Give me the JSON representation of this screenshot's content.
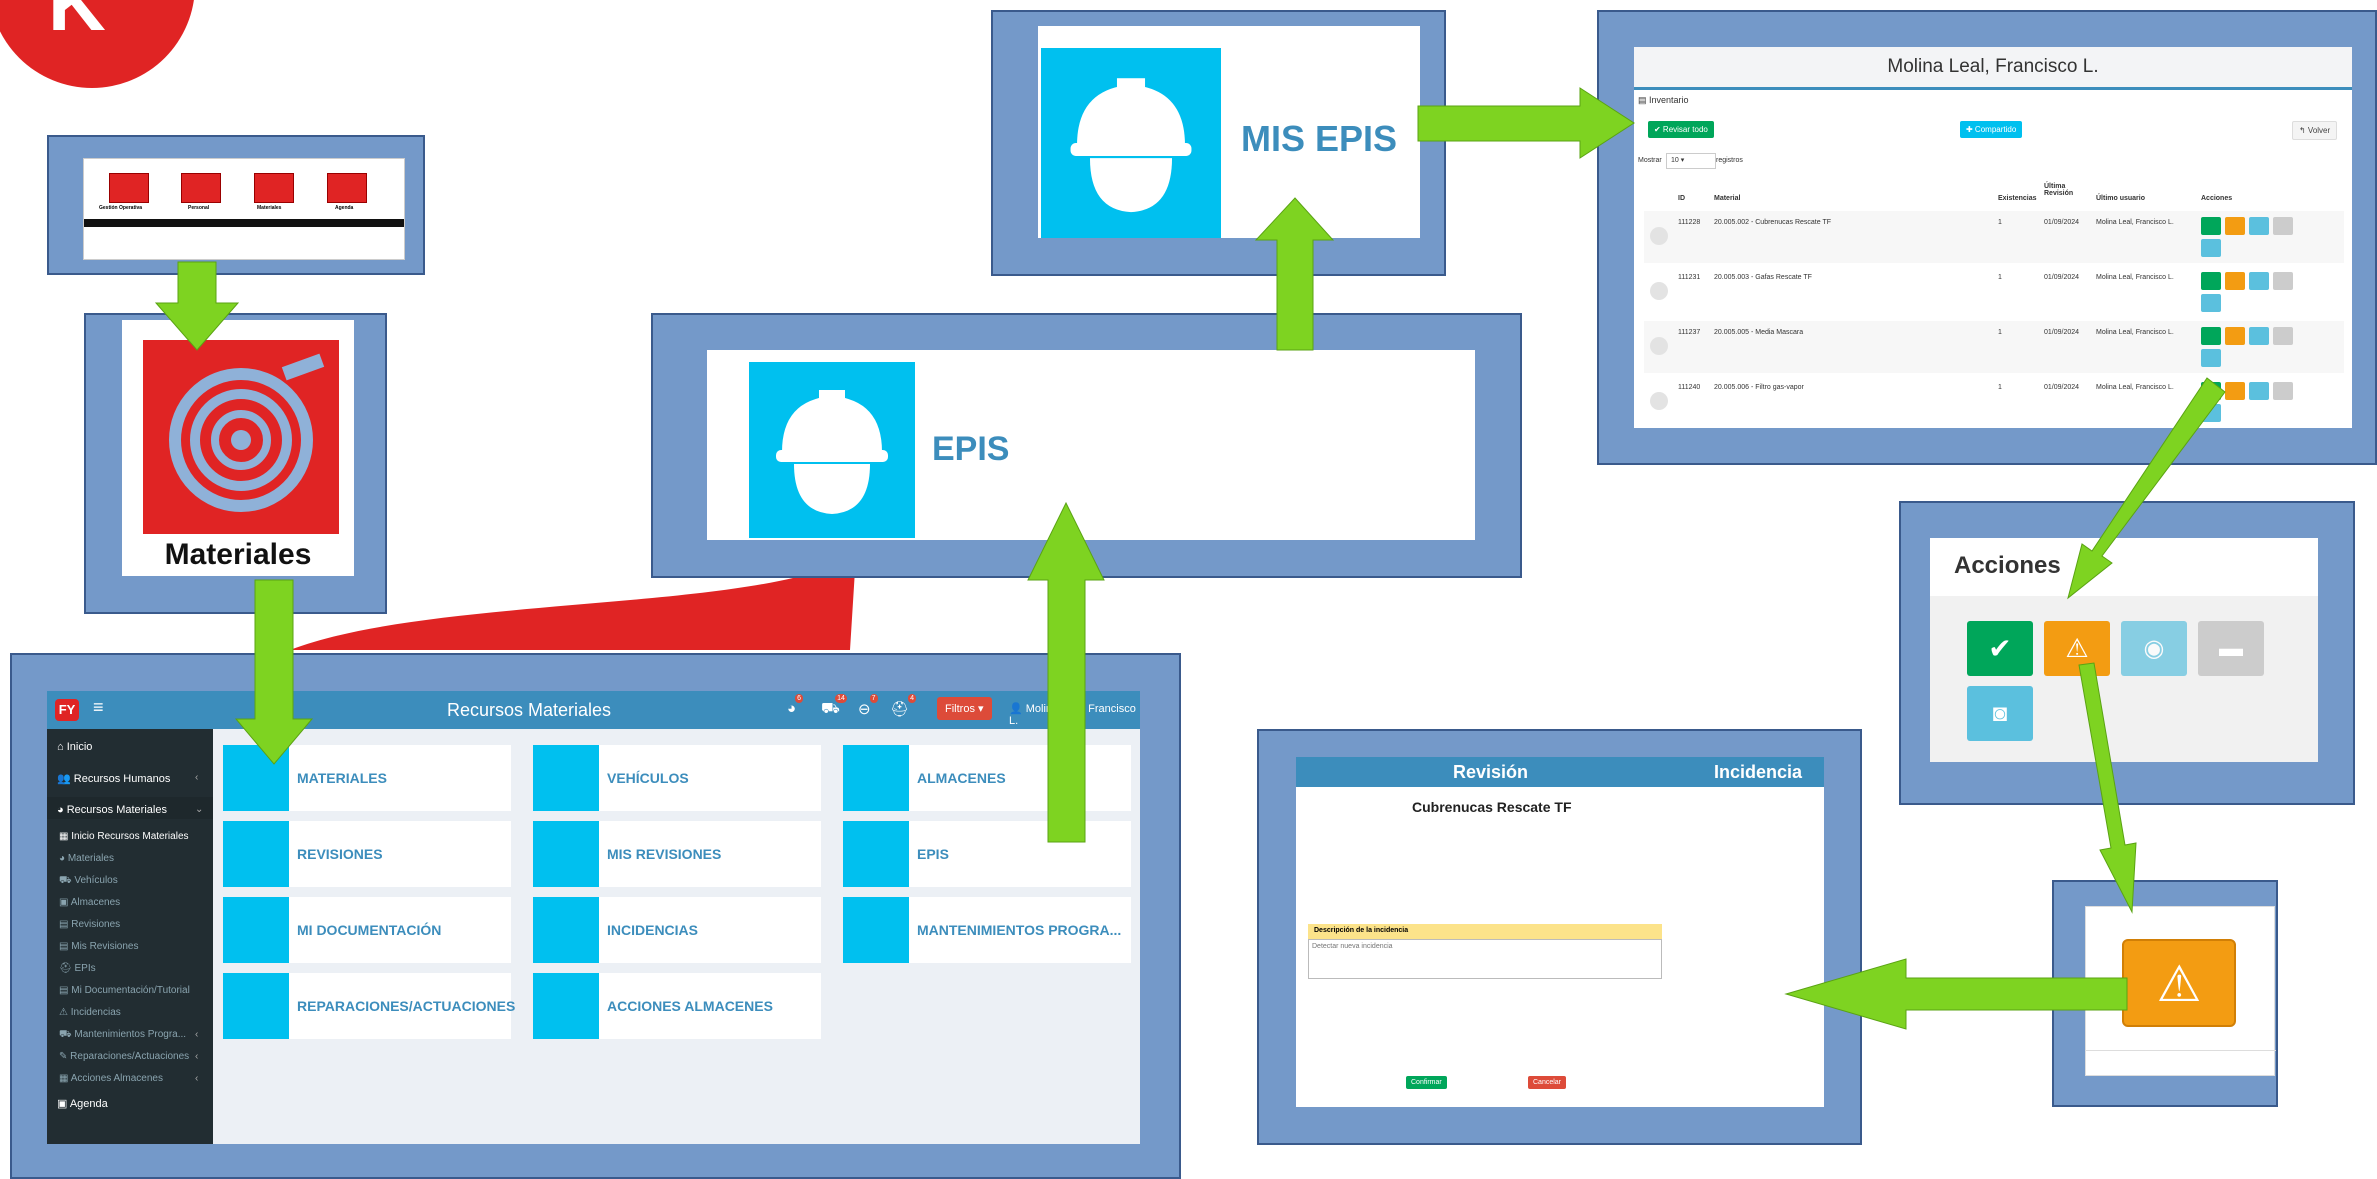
{
  "colors": {
    "frame": "#7499c9",
    "accent": "#00c0ef",
    "arrow": "#7ed321",
    "danger": "#dd4b39",
    "success": "#00a65a",
    "warning": "#f39c12"
  },
  "menu_strip": {
    "items": [
      "Gestión Operativa",
      "Personal",
      "Materiales",
      "Agenda"
    ]
  },
  "materiales_card": {
    "label": "Materiales",
    "icon": "fire-hose-icon"
  },
  "epis_card": {
    "label": "EPIS",
    "icon": "helmet-icon"
  },
  "mis_epis_card": {
    "label": "MIS EPIS",
    "icon": "helmet-icon"
  },
  "dashboard": {
    "brand": "FY",
    "title": "Recursos Materiales",
    "badges": [
      "6",
      "14",
      "7",
      "4"
    ],
    "filters_label": "Filtros ▾",
    "user": "Molina Leal, Francisco L.",
    "sidebar": [
      {
        "label": "Inicio"
      },
      {
        "label": "Recursos Humanos"
      },
      {
        "label": "Recursos Materiales"
      },
      {
        "label": "Inicio Recursos Materiales"
      },
      {
        "label": "Materiales"
      },
      {
        "label": "Vehículos"
      },
      {
        "label": "Almacenes"
      },
      {
        "label": "Revisiones"
      },
      {
        "label": "Mis Revisiones"
      },
      {
        "label": "EPIs"
      },
      {
        "label": "Mi Documentación/Tutorial"
      },
      {
        "label": "Incidencias"
      },
      {
        "label": "Mantenimientos Progra..."
      },
      {
        "label": "Reparaciones/Actuaciones"
      },
      {
        "label": "Acciones Almacenes"
      },
      {
        "label": "Agenda"
      }
    ],
    "tiles": [
      {
        "label": "MATERIALES",
        "icon": "hose-icon"
      },
      {
        "label": "VEHÍCULOS",
        "icon": "truck-icon"
      },
      {
        "label": "ALMACENES",
        "icon": "warehouse-icon"
      },
      {
        "label": "REVISIONES",
        "icon": "clipboard-check-icon"
      },
      {
        "label": "MIS REVISIONES",
        "icon": "clipboard-search-icon"
      },
      {
        "label": "EPIS",
        "icon": "helmet-icon"
      },
      {
        "label": "MI DOCUMENTACIÓN",
        "icon": "documents-icon"
      },
      {
        "label": "INCIDENCIAS",
        "icon": "warning-icon"
      },
      {
        "label": "MANTENIMIENTOS PROGRA...",
        "icon": "truck-wrench-icon"
      },
      {
        "label": "REPARACIONES/ACTUACIONES",
        "icon": "wrench-icon"
      },
      {
        "label": "ACCIONES ALMACENES",
        "icon": "sitemap-icon"
      }
    ]
  },
  "inventory": {
    "title": "Molina Leal, Francisco L.",
    "section": "Inventario",
    "review_all": "✔ Revisar todo",
    "share": "✚ Compartido",
    "back": "↰ Volver",
    "show_label": "Mostrar",
    "show_value": "10",
    "records_label": "registros",
    "columns": [
      "ID",
      "Material",
      "Existencias",
      "Última Revisión",
      "Último usuario",
      "Acciones"
    ],
    "rows": [
      {
        "id": "111228",
        "material": "20.005.002 - Cubrenucas Rescate TF",
        "stock": "1",
        "date": "01/09/2024",
        "user": "Molina Leal, Francisco L."
      },
      {
        "id": "111231",
        "material": "20.005.003 - Gafas Rescate TF",
        "stock": "1",
        "date": "01/09/2024",
        "user": "Molina Leal, Francisco L."
      },
      {
        "id": "111237",
        "material": "20.005.005 - Media Mascara",
        "stock": "1",
        "date": "01/09/2024",
        "user": "Molina Leal, Francisco L."
      },
      {
        "id": "111240",
        "material": "20.005.006 - Filtro gas-vapor",
        "stock": "1",
        "date": "01/09/2024",
        "user": "Molina Leal, Francisco L."
      }
    ]
  },
  "acciones": {
    "title": "Acciones"
  },
  "incidencia": {
    "tab_revision": "Revisión",
    "tab_incidencia": "Incidencia",
    "item": "Cubrenucas Rescate TF",
    "field_label": "Descripción de la incidencia",
    "placeholder": "Detectar nueva incidencia",
    "confirm": "Confirmar",
    "cancel": "Cancelar"
  }
}
